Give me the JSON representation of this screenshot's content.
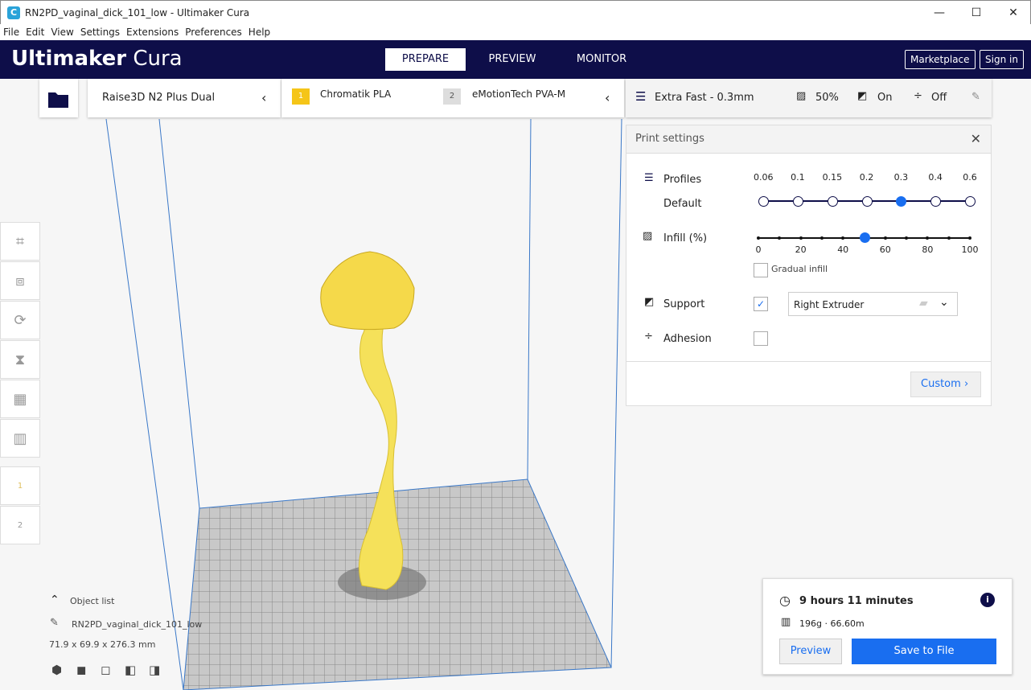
{
  "window": {
    "title": "RN2PD_vaginal_dick_101_low - Ultimaker Cura",
    "app_icon": "C"
  },
  "menu": [
    "File",
    "Edit",
    "View",
    "Settings",
    "Extensions",
    "Preferences",
    "Help"
  ],
  "header": {
    "logo_bold": "Ultimaker",
    "logo_light": "Cura",
    "tabs": [
      "PREPARE",
      "PREVIEW",
      "MONITOR"
    ],
    "marketplace": "Marketplace",
    "sign_in": "Sign in"
  },
  "stage": {
    "printer": "Raise3D N2 Plus Dual",
    "extruders": [
      {
        "num": "1",
        "material": "Chromatik PLA",
        "color": "#f5c518"
      },
      {
        "num": "2",
        "material": "eMotionTech PVA-M",
        "color": "#dddddd"
      }
    ],
    "profile": "Extra Fast - 0.3mm",
    "infill": "50%",
    "support": "On",
    "adhesion": "Off"
  },
  "print_settings": {
    "title": "Print settings",
    "profiles_label": "Profiles",
    "profile_default": "Default",
    "layer_heights": [
      "0.06",
      "0.1",
      "0.15",
      "0.2",
      "0.3",
      "0.4",
      "0.6"
    ],
    "selected_layer_index": 4,
    "infill_label": "Infill (%)",
    "infill_ticks": [
      "0",
      "20",
      "40",
      "60",
      "80",
      "100"
    ],
    "infill_value": 50,
    "gradual_infill": "Gradual infill",
    "support_label": "Support",
    "support_checked": true,
    "support_extruder": "Right Extruder",
    "adhesion_label": "Adhesion",
    "adhesion_checked": false,
    "custom": "Custom"
  },
  "object": {
    "list_label": "Object list",
    "name": "RN2PD_vaginal_dick_101_low",
    "dims": "71.9 x 69.9 x 276.3 mm"
  },
  "job": {
    "time": "9 hours 11 minutes",
    "material": "196g · 66.60m",
    "preview": "Preview",
    "save": "Save to File"
  },
  "accent": "#196ef0"
}
